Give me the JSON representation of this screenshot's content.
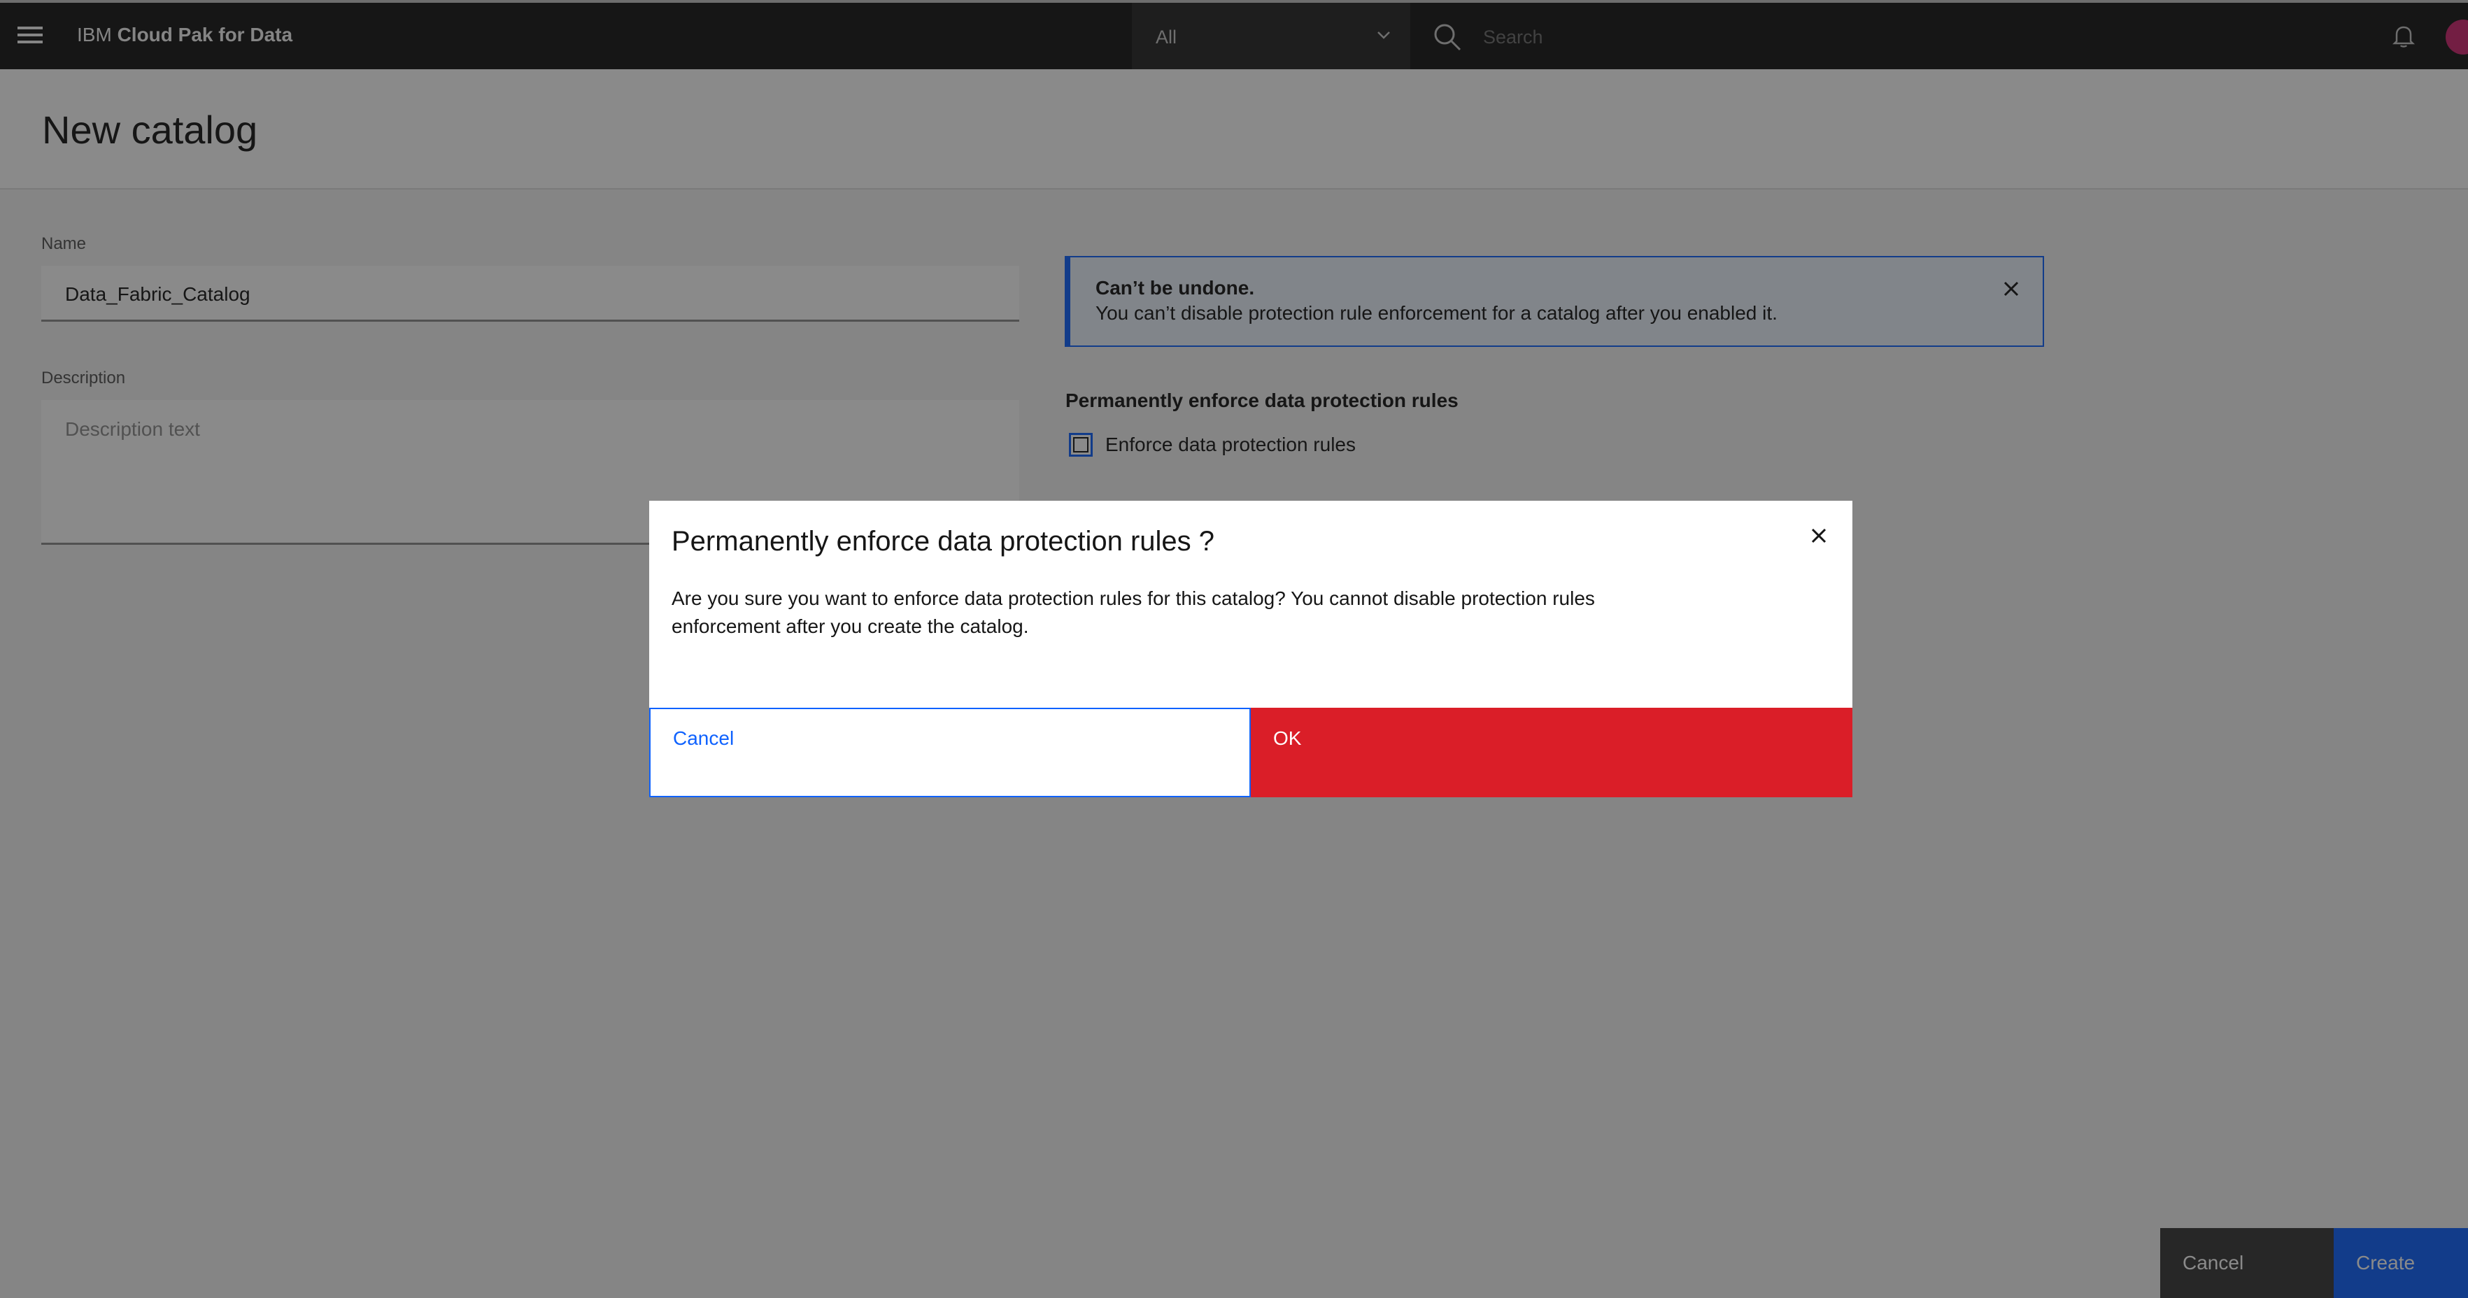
{
  "header": {
    "brand_prefix": "IBM",
    "brand_name": "Cloud Pak for Data",
    "scope_value": "All",
    "search_placeholder": "Search"
  },
  "page": {
    "title": "New catalog"
  },
  "form": {
    "name_label": "Name",
    "name_value": "Data_Fabric_Catalog",
    "description_label": "Description",
    "description_placeholder": "Description text"
  },
  "notification": {
    "title": "Can’t be undone.",
    "text": "You can’t disable protection rule enforcement for a catalog after you enabled it."
  },
  "protection": {
    "section_title": "Permanently enforce data protection rules",
    "checkbox_label": "Enforce data protection rules"
  },
  "footer": {
    "cancel_label": "Cancel",
    "create_label": "Create"
  },
  "modal": {
    "title": "Permanently enforce data protection rules ?",
    "body": "Are you sure you want to enforce data protection rules for this catalog? You cannot disable protection rules enforcement after you create the catalog.",
    "cancel_label": "Cancel",
    "ok_label": "OK"
  },
  "colors": {
    "header_bg": "#161616",
    "primary": "#0f62fe",
    "danger": "#da1e28"
  },
  "icons": [
    "menu-icon",
    "chevron-down-icon",
    "search-icon",
    "notification-icon",
    "close-icon"
  ]
}
